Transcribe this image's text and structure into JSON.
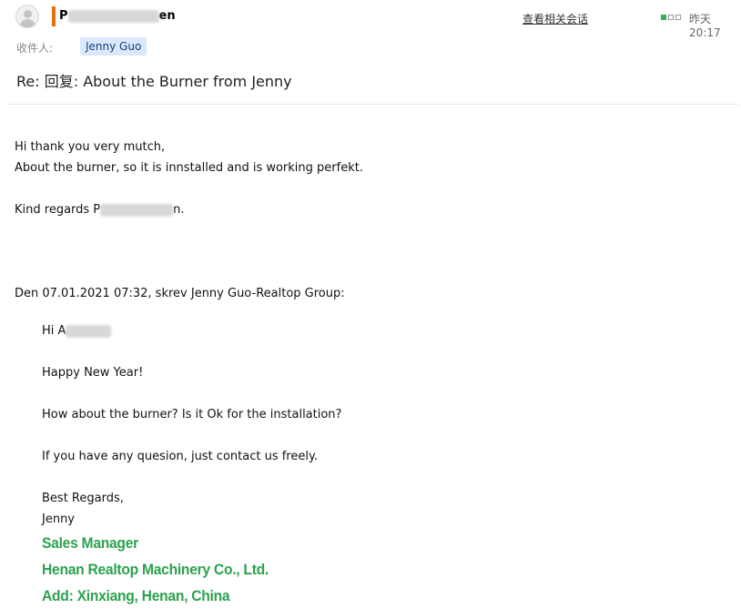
{
  "header": {
    "sender_prefix": "P",
    "sender_suffix": "en",
    "view_thread": "查看相关会话",
    "time": "昨天20:17",
    "to_label": "收件人:",
    "recipient": "Jenny Guo",
    "subject": "Re: 回复:  About the Burner from Jenny"
  },
  "message": {
    "line1": "Hi thank you very mutch,",
    "line2": "About the burner, so it is innstalled and is working perfekt.",
    "regards_prefix": "Kind regards P",
    "regards_suffix": "n."
  },
  "quoted": {
    "header": "Den 07.01.2021 07:32, skrev Jenny Guo-Realtop Group:",
    "greeting_prefix": "Hi A",
    "line1": "Happy New Year!",
    "line2": "How about the burner? Is it Ok for the installation?",
    "line3": "If you have any quesion, just contact us freely.",
    "closing": "Best Regards,",
    "name": "Jenny",
    "sig_title": "Sales Manager",
    "sig_company": "Henan Realtop Machinery Co., Ltd.",
    "sig_address": "Add: Xinxiang, Henan, China"
  },
  "colors": {
    "accent_bar": "#e8730c",
    "signature_green": "#2ca24e",
    "recipient_chip": "#d9e8fb"
  }
}
